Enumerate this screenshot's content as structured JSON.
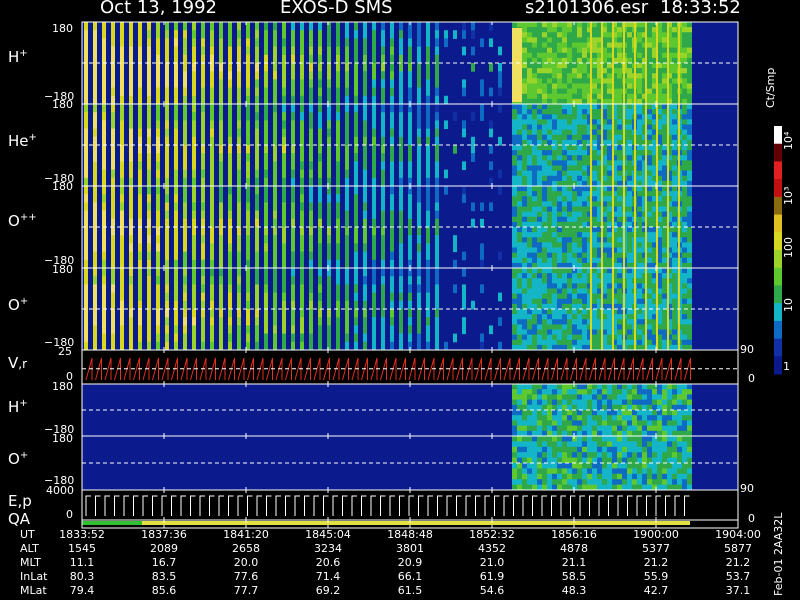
{
  "header": {
    "date": "Oct 13, 1992",
    "mission": "EXOS-D SMS",
    "file": "s2101306.esr",
    "time": "18:33:52"
  },
  "panels": [
    {
      "label": "H",
      "sup": "+",
      "ymax": "180",
      "ymin": "−180"
    },
    {
      "label": "He",
      "sup": "+",
      "ymax": "180",
      "ymin": "−180"
    },
    {
      "label": "O",
      "sup": "++",
      "ymax": "180",
      "ymin": "−180"
    },
    {
      "label": "O",
      "sup": "+",
      "ymax": "180",
      "ymin": "−180"
    },
    {
      "label": "V",
      "sup": "",
      "sub": ",r",
      "ymax": "25",
      "ymin": "0",
      "rmax": "90",
      "rmin": "0"
    },
    {
      "label": "H",
      "sup": "+",
      "ymax": "180",
      "ymin": "−180"
    },
    {
      "label": "O",
      "sup": "+",
      "ymax": "180",
      "ymin": "−180"
    },
    {
      "label": "E,p",
      "sup": "",
      "ymax": "4000",
      "ymin": "0",
      "rmax": "90",
      "rmin": "0"
    },
    {
      "label": "QA",
      "sup": ""
    }
  ],
  "colorbar": {
    "unit": "Ct/Smp",
    "labels": [
      "10⁴",
      "10³",
      "100",
      "10",
      "1"
    ]
  },
  "footer": {
    "rows": [
      {
        "name": "UT",
        "values": [
          "1833:52",
          "1837:36",
          "1841:20",
          "1845:04",
          "1848:48",
          "1852:32",
          "1856:16",
          "1900:00",
          "1904:00"
        ]
      },
      {
        "name": "ALT",
        "values": [
          "1545",
          "2089",
          "2658",
          "3234",
          "3801",
          "4352",
          "4878",
          "5377",
          "5877"
        ]
      },
      {
        "name": "MLT",
        "values": [
          "11.1",
          "16.7",
          "20.0",
          "20.6",
          "20.9",
          "21.0",
          "21.1",
          "21.2",
          "21.2"
        ]
      },
      {
        "name": "InLat",
        "values": [
          "80.3",
          "83.5",
          "77.6",
          "71.4",
          "66.1",
          "61.9",
          "58.5",
          "55.9",
          "53.7"
        ]
      },
      {
        "name": "MLat",
        "values": [
          "79.4",
          "85.6",
          "77.7",
          "69.2",
          "61.5",
          "54.6",
          "48.3",
          "42.7",
          "37.1"
        ]
      }
    ],
    "version": "Feb-01 2AA32L"
  },
  "chart_data": {
    "type": "heatmap",
    "x_tick_labels": [
      "1833:52",
      "1837:36",
      "1841:20",
      "1845:04",
      "1848:48",
      "1852:32",
      "1856:16",
      "1900:00",
      "1904:00"
    ],
    "colorscale_labels": [
      "1",
      "10",
      "100",
      "10³",
      "10⁴"
    ],
    "colorscale_unit": "Ct/Smp",
    "series": [
      {
        "name": "H+",
        "ylim": [
          -180,
          180
        ]
      },
      {
        "name": "He+",
        "ylim": [
          -180,
          180
        ]
      },
      {
        "name": "O++",
        "ylim": [
          -180,
          180
        ]
      },
      {
        "name": "O+",
        "ylim": [
          -180,
          180
        ]
      },
      {
        "name": "V,r",
        "ylim": [
          0,
          25
        ]
      },
      {
        "name": "H+",
        "ylim": [
          -180,
          180
        ]
      },
      {
        "name": "O+",
        "ylim": [
          -180,
          180
        ]
      },
      {
        "name": "E,p",
        "ylim": [
          0,
          4000
        ]
      }
    ],
    "grid": false
  }
}
